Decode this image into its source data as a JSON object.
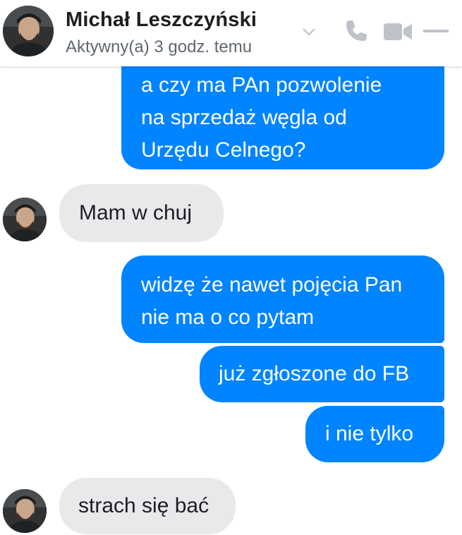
{
  "header": {
    "contact_name": "Michał Leszczyński",
    "status": "Aktywny(a) 3 godz. temu",
    "icons": [
      "chevron-down-icon",
      "phone-icon",
      "video-camera-icon",
      "minimize-icon"
    ]
  },
  "messages": [
    {
      "direction": "outgoing",
      "lines": [
        "a czy ma PAn pozwolenie",
        "na sprzedaż węgla od",
        "Urzędu Celnego?"
      ]
    },
    {
      "direction": "incoming",
      "text": "Mam w chuj"
    },
    {
      "direction": "outgoing",
      "lines": [
        "widzę że nawet pojęcia Pan",
        "nie ma o co pytam"
      ]
    },
    {
      "direction": "outgoing",
      "text": "już zgłoszone do FB"
    },
    {
      "direction": "outgoing",
      "text": "i nie tylko"
    },
    {
      "direction": "incoming",
      "text": "strach się bać"
    }
  ],
  "colors": {
    "outgoing_bubble": "#0084ff",
    "incoming_bubble": "#e9e9eb",
    "icon_gray": "#bec3c9",
    "status_text": "#606770"
  }
}
